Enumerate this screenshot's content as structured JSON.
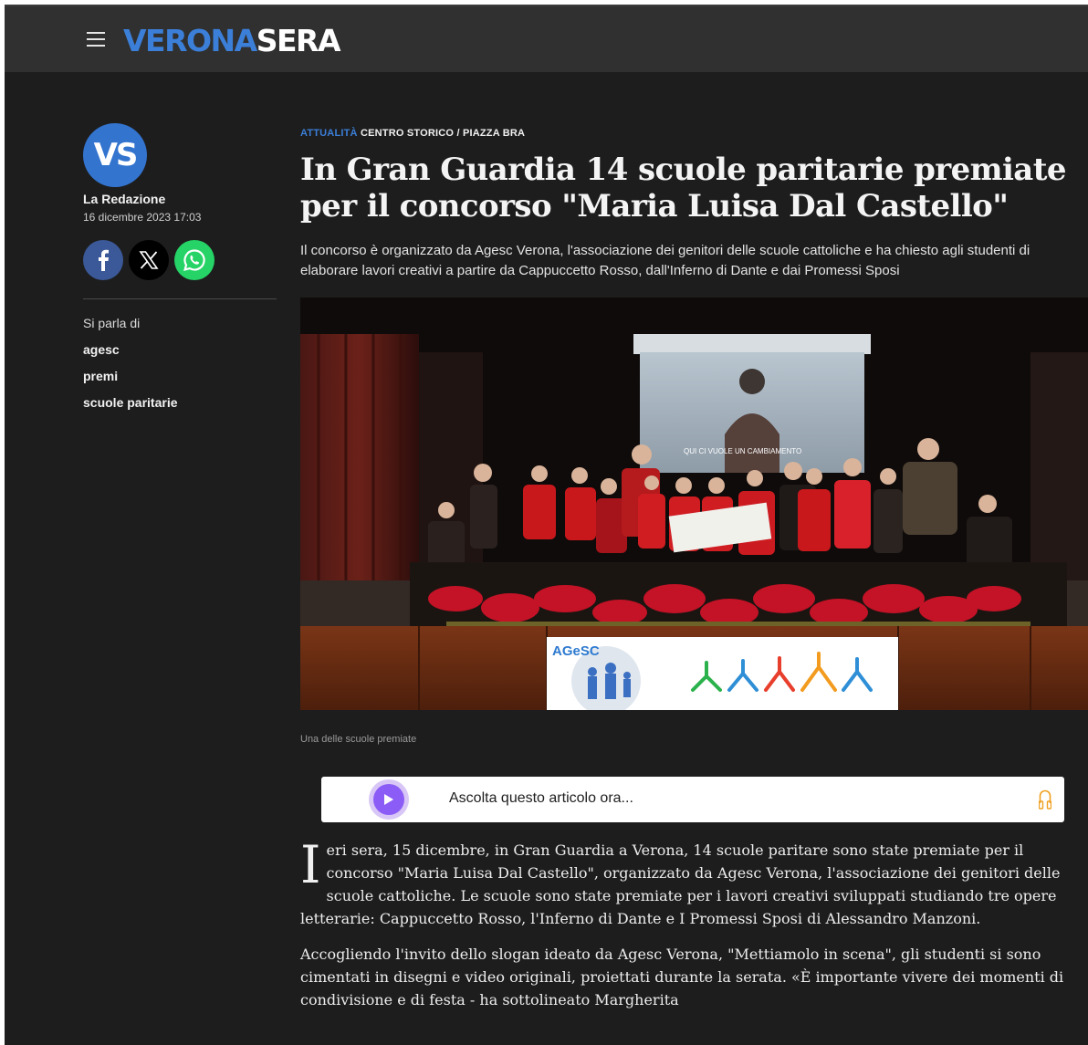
{
  "header": {
    "logo_part1": "VERONA",
    "logo_part2": "SERA"
  },
  "sidebar": {
    "avatar_initials": "VS",
    "author": "La Redazione",
    "date": "16 dicembre 2023 17:03",
    "tags_title": "Si parla di",
    "tags": [
      "agesc",
      "premi",
      "scuole paritarie"
    ]
  },
  "article": {
    "category": "ATTUALITÀ",
    "location": "CENTRO STORICO / PIAZZA BRA",
    "title": "In Gran Guardia 14 scuole paritarie premiate per il concorso \"Maria Luisa Dal Castello\"",
    "subtitle": "Il concorso è organizzato da Agesc Verona, l'associazione dei genitori delle scuole cattoliche e ha chiesto agli studenti di elaborare lavori creativi a partire da Cappuccetto Rosso, dall'Inferno di Dante e dai Promessi Sposi",
    "photo": {
      "screen_text": "QUI CI VUOLE UN CAMBIAMENTO",
      "banner_text": "AGeSC"
    },
    "caption": "Una delle scuole premiate",
    "player_label": "Ascolta questo articolo ora...",
    "dropcap": "I",
    "paragraph1": "eri sera, 15 dicembre, in Gran Guardia a Verona, 14 scuole paritare sono state premiate per il concorso \"Maria Luisa Dal Castello\", organizzato da Agesc Verona, l'associazione dei genitori delle scuole cattoliche. Le scuole sono state premiate per i lavori creativi sviluppati studiando tre opere letterarie: Cappuccetto Rosso, l'Inferno di Dante e I Promessi Sposi di Alessandro Manzoni.",
    "paragraph2": "Accogliendo l'invito dello slogan ideato da Agesc Verona, \"Mettiamolo in scena\", gli studenti si sono cimentati in disegni e video originali, proiettati durante la serata. «È importante vivere dei momenti di condivisione e di festa - ha sottolineato Margherita"
  }
}
